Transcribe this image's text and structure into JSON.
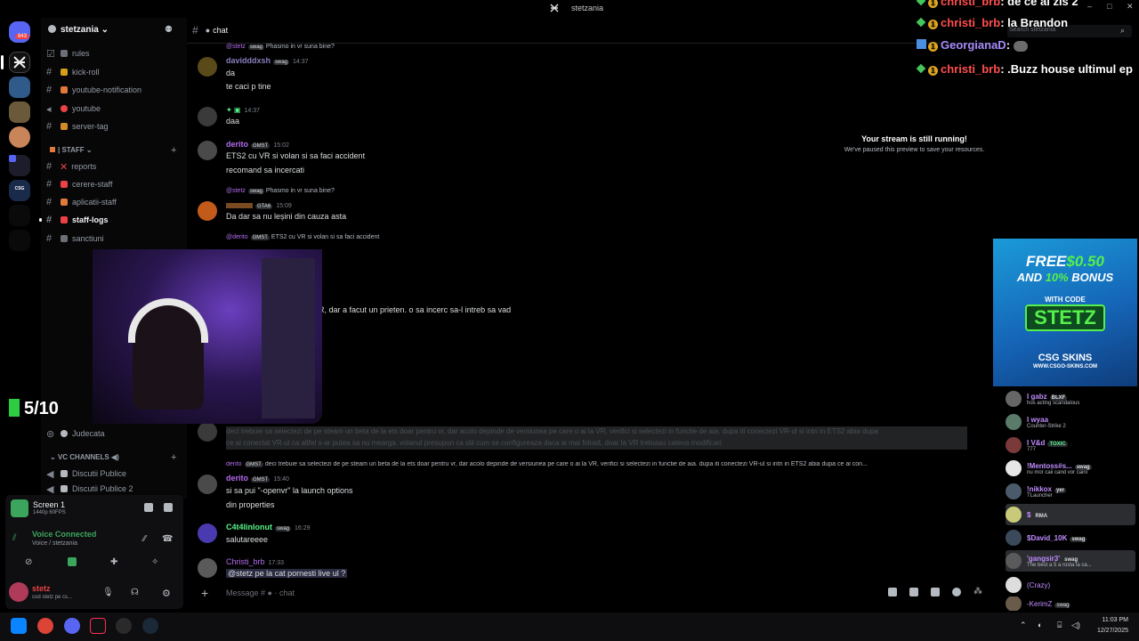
{
  "window": {
    "title": "stetzania",
    "search_placeholder": "Search stetzania"
  },
  "rail": {
    "badge": "843"
  },
  "server": {
    "name": "stetzania",
    "channels_top": [
      {
        "name": "rules",
        "color": "#6b6f77"
      },
      {
        "name": "kick-roll",
        "color": "#d4a017"
      },
      {
        "name": "youtube-notification",
        "color": "#e07a3a"
      },
      {
        "name": "youtube",
        "color": "#ed4245"
      },
      {
        "name": "server-tag",
        "color": "#d08a2a"
      }
    ],
    "staff_category": "| STAFF",
    "channels_staff": [
      {
        "name": "reports",
        "color": "#ed4245"
      },
      {
        "name": "cerere-staff",
        "color": "#ed4245"
      },
      {
        "name": "aplicatii-staff",
        "color": "#e07a3a"
      },
      {
        "name": "staff-logs",
        "color": "#ed4245"
      },
      {
        "name": "sanctiuni",
        "color": "#6b6f77"
      }
    ],
    "channel_judecata": "Judecata",
    "vc_category": "VC CHANNELS",
    "voice_channels": [
      "Discutii Publice",
      "Discutii Publice 2"
    ]
  },
  "chat": {
    "channel": "chat",
    "input_placeholder": "Message #",
    "input_channel": "chat",
    "messages": [
      {
        "reply_user": "@stetz",
        "reply_tag": "swag",
        "reply_text": "Phasmo in vr suna bine?",
        "user": "davidddxsh",
        "tag": "swag",
        "time": "14:37",
        "lines": [
          "da",
          "te caci p tine"
        ],
        "color": "#8a7fbd"
      },
      {
        "user": "",
        "tag": "",
        "time": "14:37",
        "lines": [
          "daa"
        ],
        "color": "#57f287"
      },
      {
        "user": "derito",
        "tag": "GMST",
        "time": "15:02",
        "lines": [
          "ETS2 cu VR si volan si sa faci accident",
          "recomand sa incercati"
        ],
        "color": "#b46cf0"
      },
      {
        "reply_user": "@stetz",
        "reply_tag": "swag",
        "reply_text": "Phasmo in vr suna bine?",
        "user": "",
        "tag": "GTA6",
        "time": "15:09",
        "lines": [
          "Da dar sa nu leșini din cauza asta"
        ],
        "color": "#e67e22"
      },
      {
        "reply_user": "@derito",
        "reply_tag": "GMST",
        "reply_text": "ETS2 cu VR si volan si sa faci accident",
        "user": "",
        "tag": "",
        "time": "",
        "lines": [],
        "color": "#b46cf0"
      }
    ],
    "partial_line": "R, dar a facut un prieten. o sa incerc sa-l intreb sa vad",
    "highlight_line1": "deci trebuie sa selectezi de pe steam un beta de la ets doar pentru vr, dar acolo depinde de versiunea pe care o ai la VR, verifici si selectezi in functie de aia. dupa iti conectezi VR-ul si intri in ETS2 abia dupa",
    "highlight_line2": "ce ai conectat VR-ul ca altfel s-ar putea sa nu mearga. volanul presupun ca stii cum se configureaza daca ai mai folosit, doar la VR trebuiau cateva modificari",
    "reply2_user": "derito",
    "reply2_tag": "GMST",
    "reply2_text": "deci trebuie sa selectezi de pe steam un beta de la ets doar pentru vr, dar acolo depinde de versiunea pe care o ai la VR, verifici si selectezi in functie de aia. dupa iti conectezi VR-ul si intri in ETS2 abia dupa ce ai con...",
    "msg_derito2": {
      "user": "derito",
      "tag": "GMST",
      "time": "15:40",
      "lines": [
        "si sa pui \"-openvr\" la launch options",
        "din properties"
      ]
    },
    "msg_catalin": {
      "user": "C4t4linIonut",
      "tag": "swag",
      "time": "16:29",
      "lines": [
        "salutareeee"
      ]
    },
    "msg_christi": {
      "user": "Christi_brb",
      "time": "17:33",
      "lines": [
        "@stetz pe la cat pornesti live ul ?"
      ]
    }
  },
  "stream_notice": {
    "title": "Your stream is still running!",
    "body": "We've paused this preview to save your resources."
  },
  "counter": "5/10",
  "screen_share": {
    "title": "Screen 1",
    "sub": "1440p 60FPS"
  },
  "voice": {
    "status": "Voice Connected",
    "channel": "Voice / stetzania"
  },
  "user": {
    "name": "stetz",
    "status": "cod stetz pe cs..."
  },
  "twitch_chat": [
    {
      "user": "christi_brb",
      "text": "de ce ai zis 2",
      "color": "#ff4d4d"
    },
    {
      "user": "christi_brb",
      "text": "la Brandon",
      "color": "#ff4d4d"
    },
    {
      "user": "GeorgianaD",
      "text": "",
      "color": "#a78bfa"
    },
    {
      "user": "christi_brb",
      "text": ".Buzz house ultimul ep",
      "color": "#ff4d4d"
    }
  ],
  "ad": {
    "line1": "FREE",
    "amount": "$0.50",
    "line2": "AND",
    "pct": "10%",
    "bonus": "BONUS",
    "with_code": "WITH CODE",
    "code": "STETZ",
    "brand": "CSG SKINS",
    "url": "WWW.CSGO-SKINS.COM"
  },
  "members": [
    {
      "name": "I gabz",
      "tag": "BLXF",
      "sub": "hos acting scandalous",
      "color": "#c08cff"
    },
    {
      "name": "I wyaa",
      "tag": "",
      "sub": "Counter-Strike 2",
      "color": "#c08cff"
    },
    {
      "name": "I V&d",
      "tag": "TOXIC",
      "sub": "777",
      "color": "#c08cff"
    },
    {
      "name": "!Mentoss#s...",
      "tag": "swag",
      "sub": "nu mor caii cand vor caini",
      "color": "#c08cff"
    },
    {
      "name": "!nikkox",
      "tag": "yer",
      "sub": "TLauncher",
      "color": "#c08cff"
    },
    {
      "name": "$",
      "tag": "RMA",
      "sub": "",
      "color": "#c08cff"
    },
    {
      "name": "$David_10K",
      "tag": "swag",
      "sub": "",
      "color": "#c08cff"
    },
    {
      "name": "'gangsir3'",
      "tag": "swag",
      "sub": "The best a 5 a rosta la ca...",
      "color": "#c08cff"
    },
    {
      "name": "(Crazy)",
      "tag": "",
      "sub": "",
      "color": "#c08cff"
    },
    {
      "name": "-KerimZ",
      "tag": "swag",
      "sub": "",
      "color": "#c08cff"
    }
  ],
  "clock": {
    "time": "11:03 PM",
    "date": "12/27/2025"
  }
}
